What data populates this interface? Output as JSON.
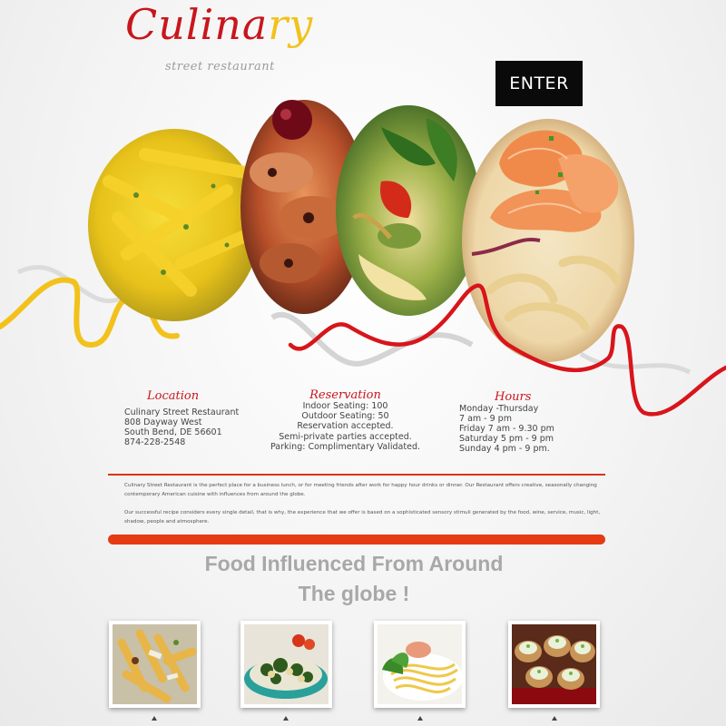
{
  "brand": {
    "name_main": "Culina",
    "name_accent": "ry",
    "subtitle": "street restaurant"
  },
  "header": {
    "enter_label": "ENTER"
  },
  "info": {
    "location": {
      "title": "Location",
      "lines": [
        "Culinary Street Restaurant",
        "808  Dayway West",
        "South Bend, DE 56601",
        "874-228-2548"
      ]
    },
    "reservation": {
      "title": "Reservation",
      "lines": [
        "Indoor Seating: 100",
        "Outdoor Seating: 50",
        "Reservation accepted.",
        "Semi-private parties accepted.",
        "Parking: Complimentary Validated."
      ]
    },
    "hours": {
      "title": "Hours",
      "lines": [
        "Monday -Thursday",
        "7 am - 9 pm",
        "Friday 7 am - 9.30 pm",
        "Saturday 5 pm - 9 pm",
        "Sunday 4 pm - 9 pm."
      ]
    }
  },
  "about": {
    "paragraph_1": "Culinary Street Restaurant is the perfect place for a business lunch, or for meeting friends after work for happy hour drinks or dinner. Our Restaurant offers creative, seasonally changing contemporary American cuisine with influences from around the globe.",
    "paragraph_2": "Our successful recipe considers every single detail, that is why, the experience that we offer is based on a sophisticated sensory stimuli generated by the food, wine, service, music, light, shadow, people and atmosphere."
  },
  "tagline": {
    "line_1": "Food Influenced From Around",
    "line_2": "The globe !"
  },
  "colors": {
    "brand_red": "#c8161d",
    "brand_yellow": "#f2c21b",
    "accent_orange": "#e53a12",
    "enter_bg": "#0a0a0a"
  },
  "gallery_icons": [
    "pasta-thumbnail",
    "salad-thumbnail",
    "spaghetti-thumbnail",
    "appetizer-thumbnail"
  ]
}
